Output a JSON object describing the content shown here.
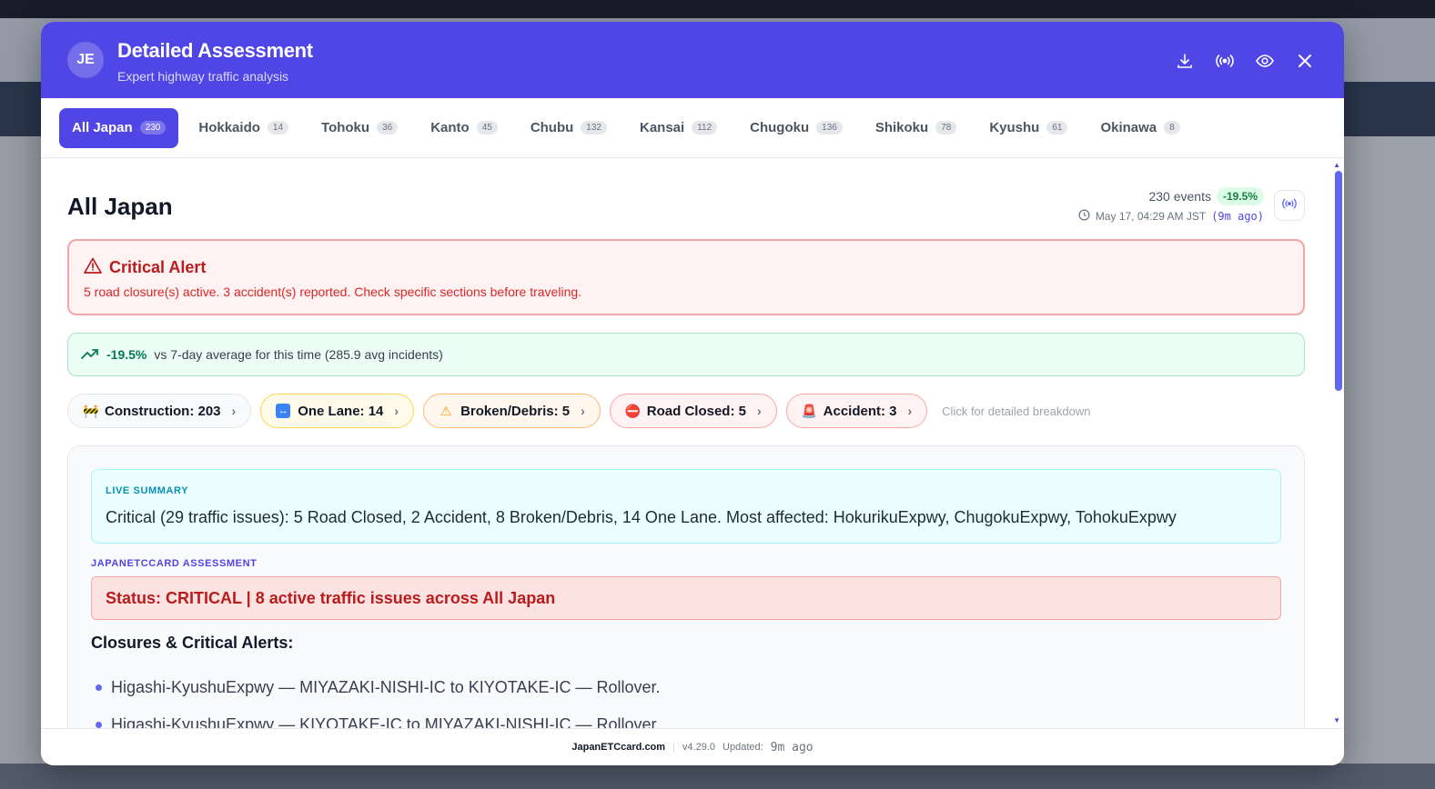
{
  "header": {
    "avatar_initials": "JE",
    "title": "Detailed Assessment",
    "subtitle": "Expert highway traffic analysis",
    "icons": [
      "download-icon",
      "broadcast-icon",
      "eye-icon",
      "close-icon"
    ]
  },
  "tabs": [
    {
      "label": "All Japan",
      "count": "230",
      "active": true
    },
    {
      "label": "Hokkaido",
      "count": "14"
    },
    {
      "label": "Tohoku",
      "count": "36"
    },
    {
      "label": "Kanto",
      "count": "45"
    },
    {
      "label": "Chubu",
      "count": "132"
    },
    {
      "label": "Kansai",
      "count": "112"
    },
    {
      "label": "Chugoku",
      "count": "136"
    },
    {
      "label": "Shikoku",
      "count": "78"
    },
    {
      "label": "Kyushu",
      "count": "61"
    },
    {
      "label": "Okinawa",
      "count": "8"
    }
  ],
  "main": {
    "region_title": "All Japan",
    "events_text": "230 events",
    "pct_badge": "-19.5%",
    "timestamp": "May 17, 04:29 AM JST",
    "ago": "(9m ago)"
  },
  "alert": {
    "title": "Critical Alert",
    "body": "5 road closure(s) active. 3 accident(s) reported. Check specific sections before traveling."
  },
  "trend": {
    "pct": "-19.5%",
    "text": "vs 7-day average for this time (285.9 avg incidents)"
  },
  "chips": [
    {
      "icon": "🚧",
      "label": "Construction: 203",
      "style": "grey"
    },
    {
      "icon": "↔",
      "label": "One Lane: 14",
      "style": "yellow"
    },
    {
      "icon": "⚠",
      "label": "Broken/Debris: 5",
      "style": "orange"
    },
    {
      "icon": "⛔",
      "label": "Road Closed: 5",
      "style": "red"
    },
    {
      "icon": "🚨",
      "label": "Accident: 3",
      "style": "red"
    }
  ],
  "chips_hint": "Click for detailed breakdown",
  "live_summary": {
    "label": "LIVE SUMMARY",
    "text": "Critical (29 traffic issues): 5 Road Closed, 2 Accident, 8 Broken/Debris, 14 One Lane. Most affected: HokurikuExpwy, ChugokuExpwy, TohokuExpwy"
  },
  "assessment": {
    "label": "JAPANETCCARD ASSESSMENT",
    "status": "Status: CRITICAL | 8 active traffic issues across All Japan",
    "closures_heading": "Closures & Critical Alerts:",
    "items": [
      "Higashi-KyushuExpwy — MIYAZAKI-NISHI-IC to KIYOTAKE-IC — Rollover.",
      "Higashi-KyushuExpwy — KIYOTAKE-IC to MIYAZAKI-NISHI-IC — Rollover."
    ]
  },
  "footer": {
    "brand": "JapanETCcard.com",
    "version": "v4.29.0",
    "updated_label": "Updated:",
    "updated_value": "9m ago"
  },
  "colors": {
    "accent": "#4f46e5",
    "critical": "#b91c1c",
    "positive": "#047857"
  }
}
